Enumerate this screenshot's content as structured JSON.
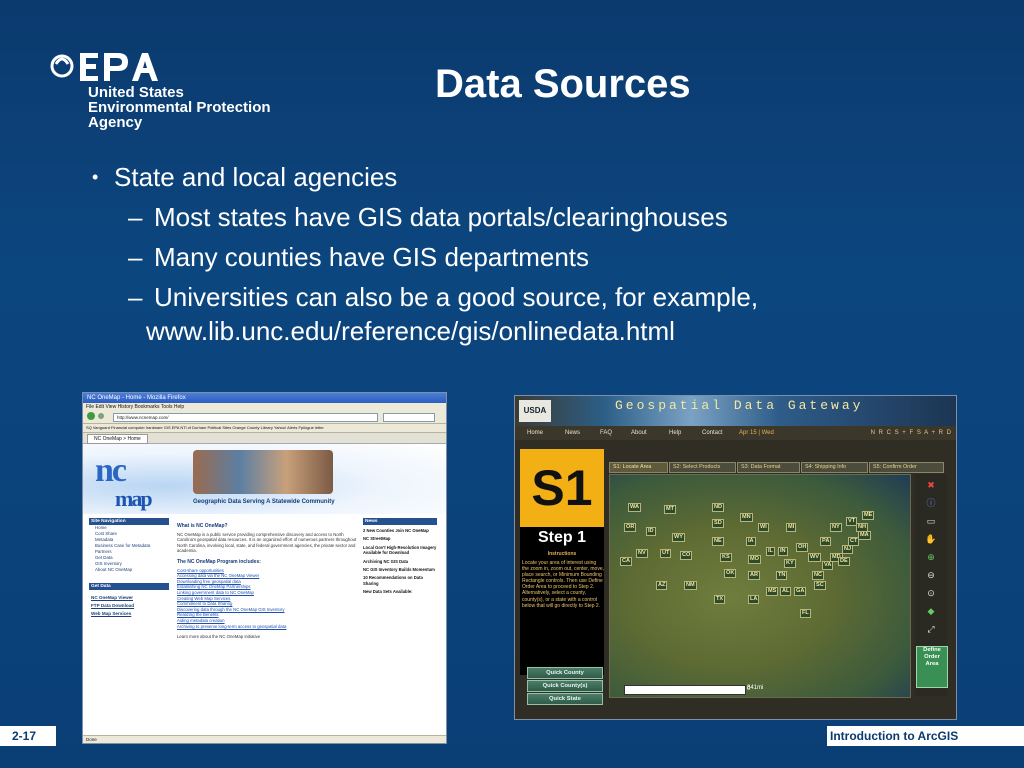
{
  "logo": {
    "brand": "EPA",
    "lines": [
      "United States",
      "Environmental Protection",
      "Agency"
    ]
  },
  "title": "Data Sources",
  "bullets": {
    "level1": "State and local agencies",
    "level2": [
      "Most states have GIS data portals/clearinghouses",
      "Many counties have GIS departments",
      "Universities can also be a good source, for example,"
    ],
    "url": "www.lib.unc.edu/reference/gis/onlinedata.html"
  },
  "left_screenshot": {
    "window_title": "NC OneMap - Home - Mozilla Firefox",
    "menu": "File  Edit  View  History  Bookmarks  Tools  Help",
    "url": "http://www.ncnemap.com/",
    "bookmarks": "SQ  Vanguard  Financial  computer hardware  GIS  EPA  NTl of Durham  Political Sites  Orange County Library  Yahoo! Alerts  Fpilogue letter",
    "tab": "NC OneMap > Home",
    "logo_top": "nc",
    "logo_bottom": "map",
    "tagline": "Geographic Data Serving A Statewide Community",
    "site_nav_head": "Site Navigation",
    "site_nav": [
      "Home",
      "Cost Share",
      "Metadata",
      "Business Case for Metadata",
      "Partners",
      "Get Data",
      "GIS Inventory",
      "About NC OneMap"
    ],
    "get_data_head": "Get Data",
    "get_data": [
      "NC OneMap Viewer",
      "FTP Data Download",
      "Web Map Services"
    ],
    "main_head": "What is NC OneMap?",
    "main_text": "NC OneMap is a public service providing comprehensive discovery and access to North Carolina's geospatial data resources. It is an organized effort of numerous partners throughout North Carolina, involving local, state, and federal government agencies, the private sector and academia.",
    "program_head": "The NC OneMap Program includes:",
    "program": [
      "Cost-share opportunities",
      "Accessing data via the NC OneMap Viewer",
      "Downloading free geospatial data",
      "Establishing NC OneMap Partnerships",
      "Linking government data to NC OneMap",
      "Creating Web Map Services",
      "Commitment to Data Sharing",
      "Discovering data through the NC OneMap GIS Inventory",
      "Realizing the Benefits",
      "Aiding metadata creation",
      "Archiving to preserve long-term access to geospatial data"
    ],
    "learn_more": "Learn more about the NC OneMap Initiative",
    "news_head": "News",
    "news": [
      "2 New Counties Join NC OneMap",
      "NC StreetMap",
      "Local Gov't High-Resolution Imagery Available for Download",
      "Archiving NC GIS Data",
      "NC GIS Inventory Builds Momentum",
      "10 Recommendations on Data Sharing",
      "New Data Sets Available:"
    ],
    "status": "Done"
  },
  "right_screenshot": {
    "usda": "USDA",
    "logo": "Geospatial  Data Gateway",
    "nav": [
      "Home",
      "News",
      "FAQ",
      "About",
      "Help",
      "Contact"
    ],
    "date": "Apr 15 | Wed",
    "partners": "N R C S + F S A + R D",
    "step_badge": "S1",
    "step_title": "Step 1",
    "instructions_head": "Instructions",
    "instructions": "Locate your area of interest using the zoom in, zoom out, center, move, place search, or Minimum Bounding Rectangle controls. Then use Define Order Area to proceed to Step 2. Alternatively, select a county, county(s), or a state with a control below that will go directly to Step 2.",
    "quick_buttons": [
      "Quick County",
      "Quick County(s)",
      "Quick State"
    ],
    "tabs": [
      "S1: Locate Area",
      "S2: Select Products",
      "S3: Data Format",
      "S4: Shipping Info",
      "S5: Confirm Order"
    ],
    "states": [
      "WA",
      "MT",
      "ND",
      "MN",
      "ME",
      "OR",
      "ID",
      "SD",
      "WI",
      "MI",
      "NY",
      "VT",
      "NH",
      "MA",
      "WY",
      "NE",
      "IA",
      "IL",
      "IN",
      "OH",
      "PA",
      "NJ",
      "CT",
      "NV",
      "UT",
      "CO",
      "KS",
      "MO",
      "KY",
      "WV",
      "MD",
      "VA",
      "DE",
      "CA",
      "AZ",
      "NM",
      "OK",
      "AR",
      "TN",
      "NC",
      "SC",
      "TX",
      "LA",
      "MS",
      "AL",
      "GA",
      "FL"
    ],
    "scale_left": "0",
    "scale_right": "841mi",
    "define_order": "Define Order Area"
  },
  "footer": {
    "page": "2-17",
    "course": "Introduction to ArcGIS"
  }
}
